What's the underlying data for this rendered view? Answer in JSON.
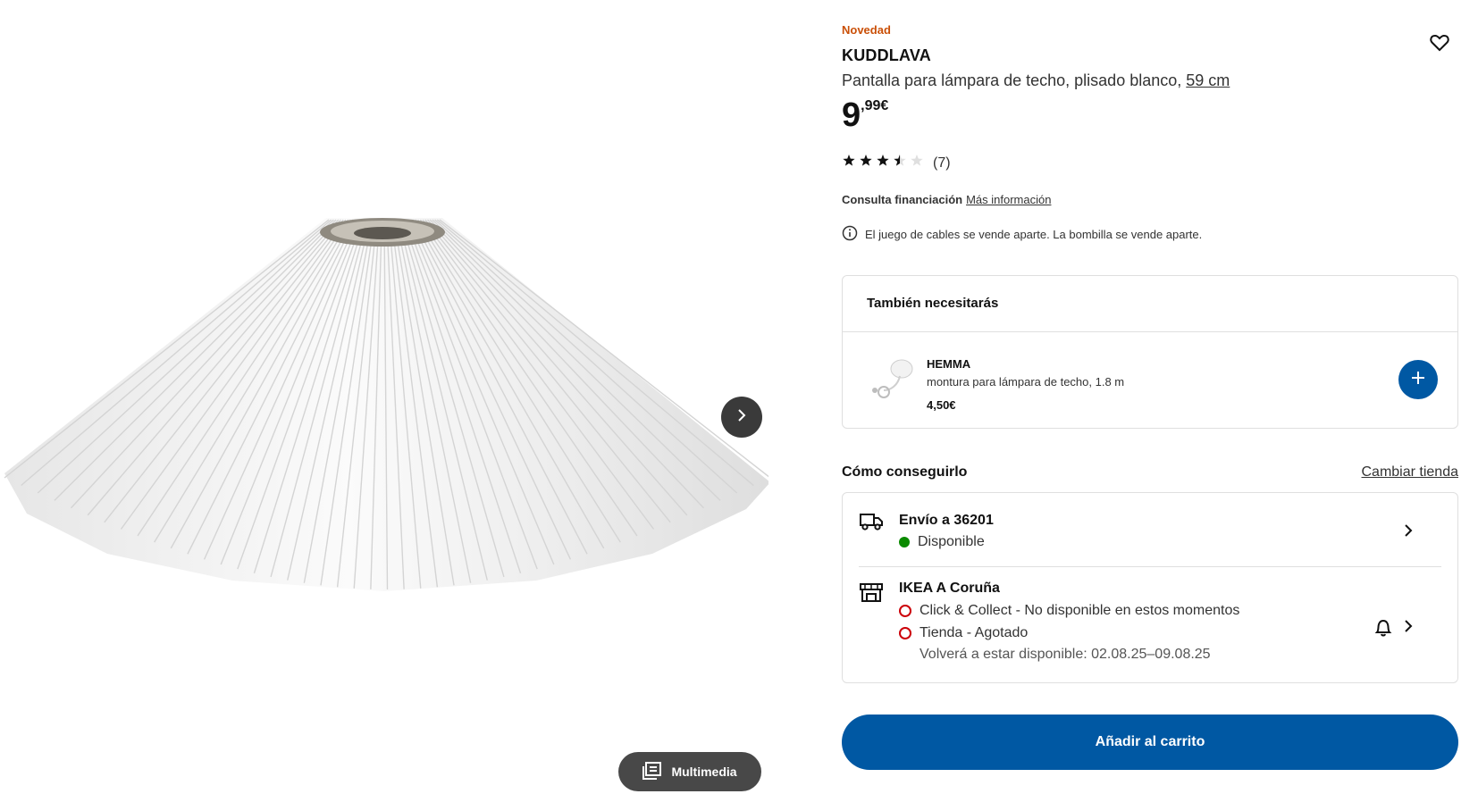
{
  "gallery": {
    "image_alt_icon": "pleated-lampshade-image",
    "next_icon": "chevron-right-icon",
    "media_label": "Multimedia"
  },
  "product": {
    "badge": "Novedad",
    "name": "KUDDLAVA",
    "description": "Pantalla para lámpara de techo, plisado blanco,",
    "size_link": "59 cm",
    "price_int": "9",
    "price_dec": ",99€",
    "rating_value": 3.5,
    "rating_max": 5,
    "review_count": "(7)"
  },
  "finance": {
    "label": "Consulta financiación",
    "link": "Más información"
  },
  "note": "El juego de cables se vende aparte. La bombilla se vende aparte.",
  "also_need": {
    "title": "También necesitarás",
    "item": {
      "name": "HEMMA",
      "description": "montura para lámpara de techo, 1.8 m",
      "price": "4,50€"
    }
  },
  "availability": {
    "title": "Cómo conseguirlo",
    "change_store": "Cambiar tienda",
    "delivery": {
      "heading": "Envío a 36201",
      "status": "Disponible"
    },
    "store": {
      "heading": "IKEA A Coruña",
      "click_collect": "Click & Collect - No disponible en estos momentos",
      "in_store": "Tienda - Agotado",
      "restock": "Volverá a estar disponible: 02.08.25–09.08.25"
    }
  },
  "cart_button": "Añadir al carrito",
  "colors": {
    "brand_blue": "#0058a3",
    "new_orange": "#ca5008",
    "available_green": "#0a8a00",
    "unavailable_red": "#cc0008"
  }
}
